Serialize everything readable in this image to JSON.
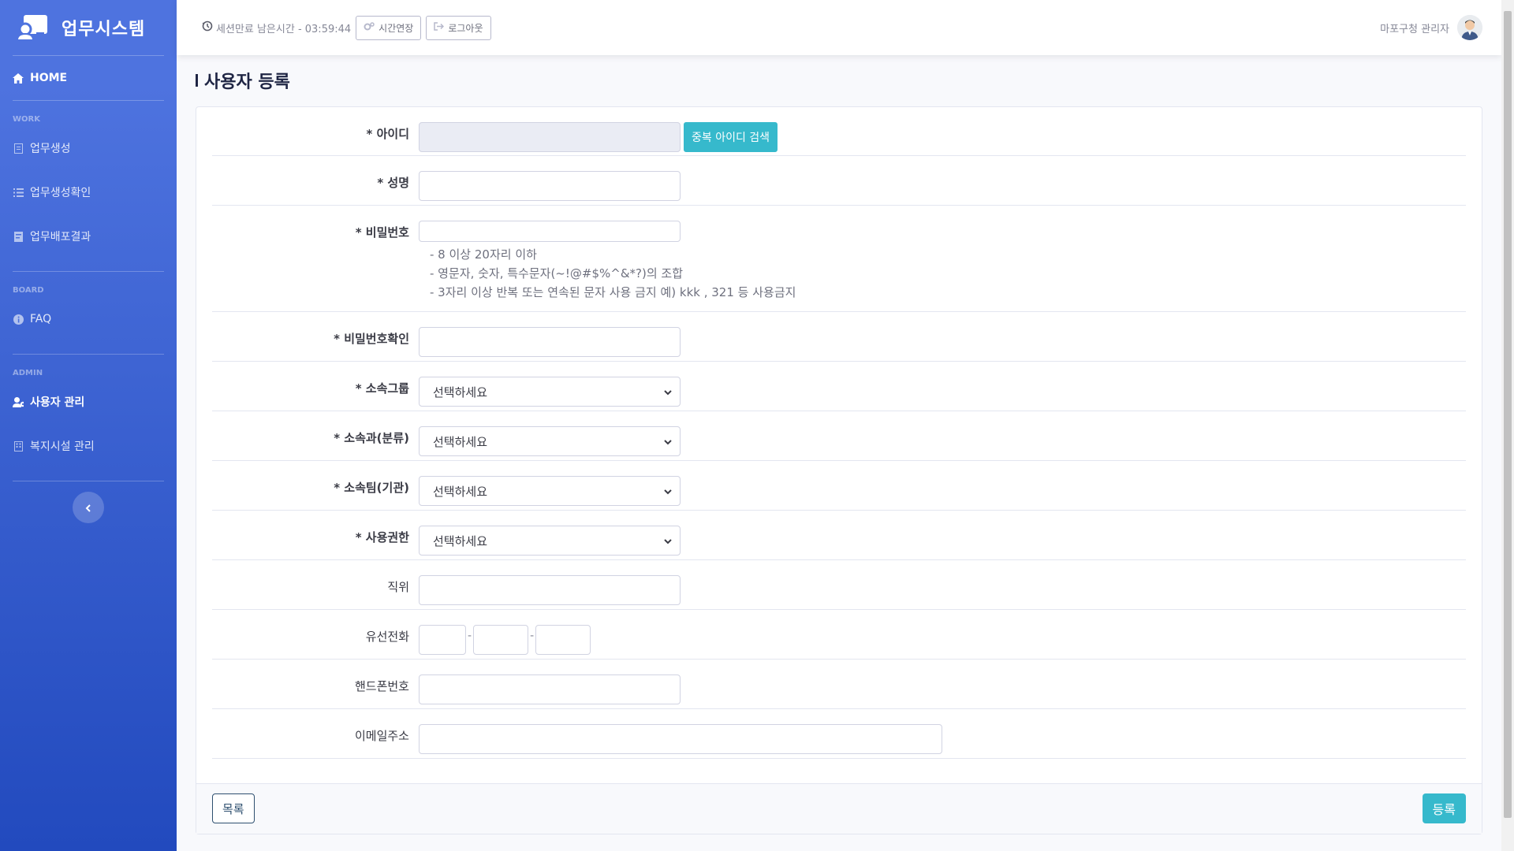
{
  "sidebar": {
    "brand": "업무시스템",
    "home": "HOME",
    "sections": [
      {
        "heading": "WORK",
        "items": [
          {
            "label": "업무생성",
            "icon": "file-icon"
          },
          {
            "label": "업무생성확인",
            "icon": "list-icon"
          },
          {
            "label": "업무배포결과",
            "icon": "report-icon"
          }
        ]
      },
      {
        "heading": "BOARD",
        "items": [
          {
            "label": "FAQ",
            "icon": "info-icon"
          }
        ]
      },
      {
        "heading": "ADMIN",
        "items": [
          {
            "label": "사용자 관리",
            "icon": "user-gear-icon",
            "active": true
          },
          {
            "label": "복지시설 관리",
            "icon": "building-icon"
          }
        ]
      }
    ]
  },
  "topbar": {
    "session_text": "세션만료 남은시간 - 03:59:44",
    "extend_label": "시간연장",
    "logout_label": "로그아웃",
    "user_name": "마포구청 관리자"
  },
  "page": {
    "title": "사용자 등록"
  },
  "form": {
    "id_label": "* 아이디",
    "id_check_button": "중복 아이디 검색",
    "name_label": "* 성명",
    "password_label": "* 비밀번호",
    "password_hints": [
      "- 8 이상 20자리 이하",
      "- 영문자, 숫자, 특수문자(~!@#$%^&*?)의 조합",
      "- 3자리 이상 반복 또는 연속된 문자 사용 금지 예) kkk , 321 등 사용금지"
    ],
    "password_confirm_label": "* 비밀번호확인",
    "group_label": "* 소속그룹",
    "dept_label": "* 소속과(분류)",
    "team_label": "* 소속팀(기관)",
    "role_label": "* 사용권한",
    "select_placeholder": "선택하세요",
    "position_label": "직위",
    "phone_label": "유선전화",
    "mobile_label": "핸드폰번호",
    "email_label": "이메일주소",
    "dash": "-"
  },
  "footer": {
    "list_button": "목록",
    "submit_button": "등록"
  },
  "colors": {
    "sidebar_top": "#4e73df",
    "sidebar_bottom": "#224abe",
    "accent": "#36b9cc"
  }
}
